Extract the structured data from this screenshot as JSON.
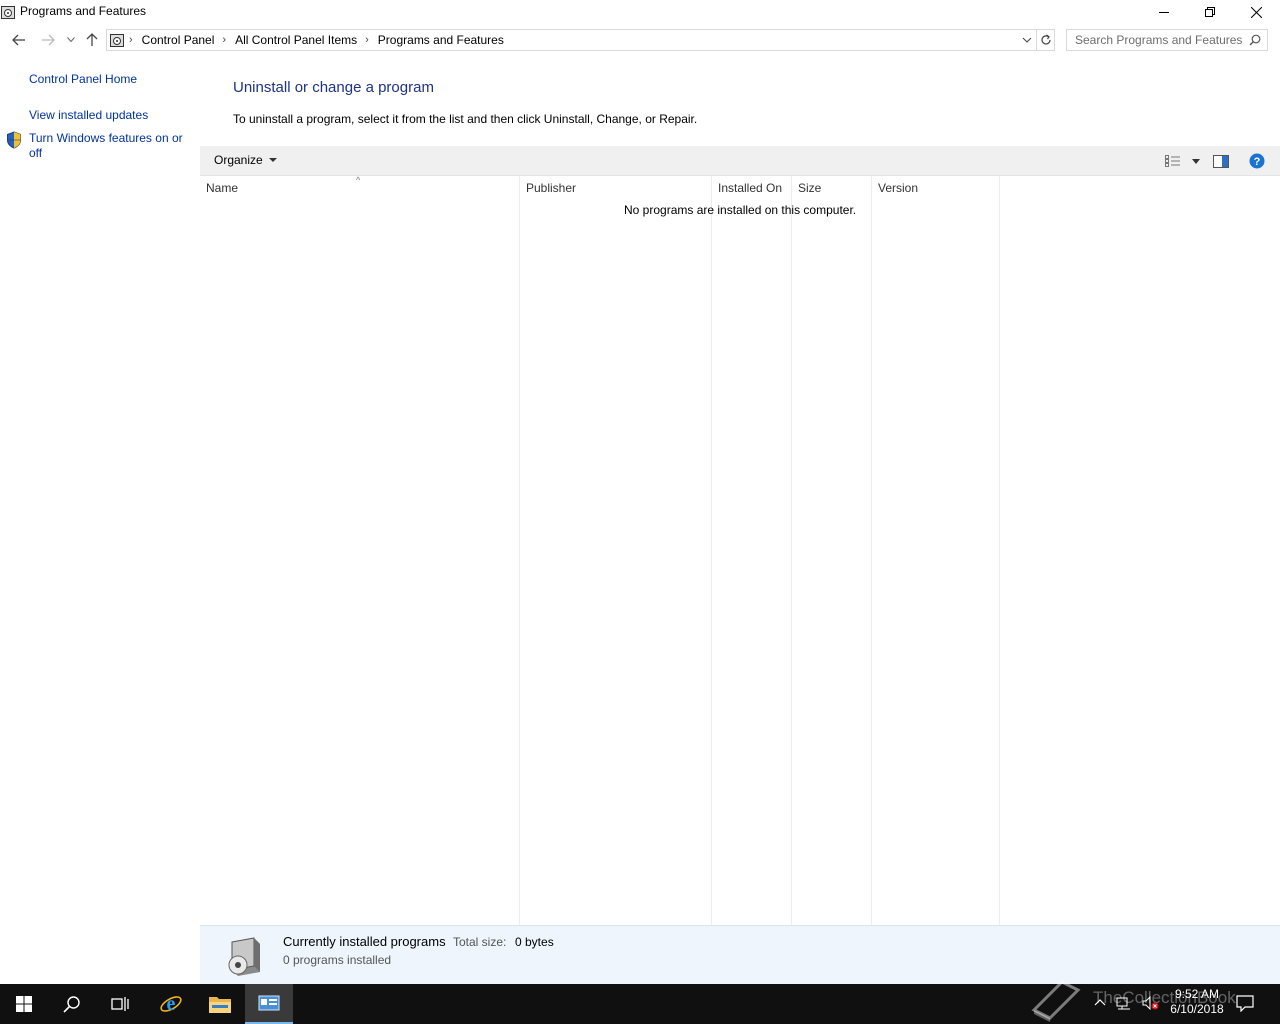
{
  "window": {
    "title": "Programs and Features"
  },
  "address": {
    "crumbs": [
      "Control Panel",
      "All Control Panel Items",
      "Programs and Features"
    ]
  },
  "search": {
    "placeholder": "Search Programs and Features"
  },
  "left_pane": {
    "home": "Control Panel Home",
    "updates": "View installed updates",
    "features": "Turn Windows features on or off"
  },
  "main": {
    "title": "Uninstall or change a program",
    "subtitle": "To uninstall a program, select it from the list and then click Uninstall, Change, or Repair."
  },
  "toolbar": {
    "organize": "Organize"
  },
  "list": {
    "columns": [
      "Name",
      "Publisher",
      "Installed On",
      "Size",
      "Version"
    ],
    "empty_message": "No programs are installed on this computer."
  },
  "details": {
    "title": "Currently installed programs",
    "total_label": "Total size:",
    "total_value": "0 bytes",
    "count": "0 programs installed"
  },
  "taskbar": {
    "watermark": "TheCollectionBook",
    "time": "9:52 AM",
    "date": "6/10/2018"
  },
  "colors": {
    "link": "#0033a0",
    "title": "#1e3287",
    "accent": "#76b9ed"
  }
}
